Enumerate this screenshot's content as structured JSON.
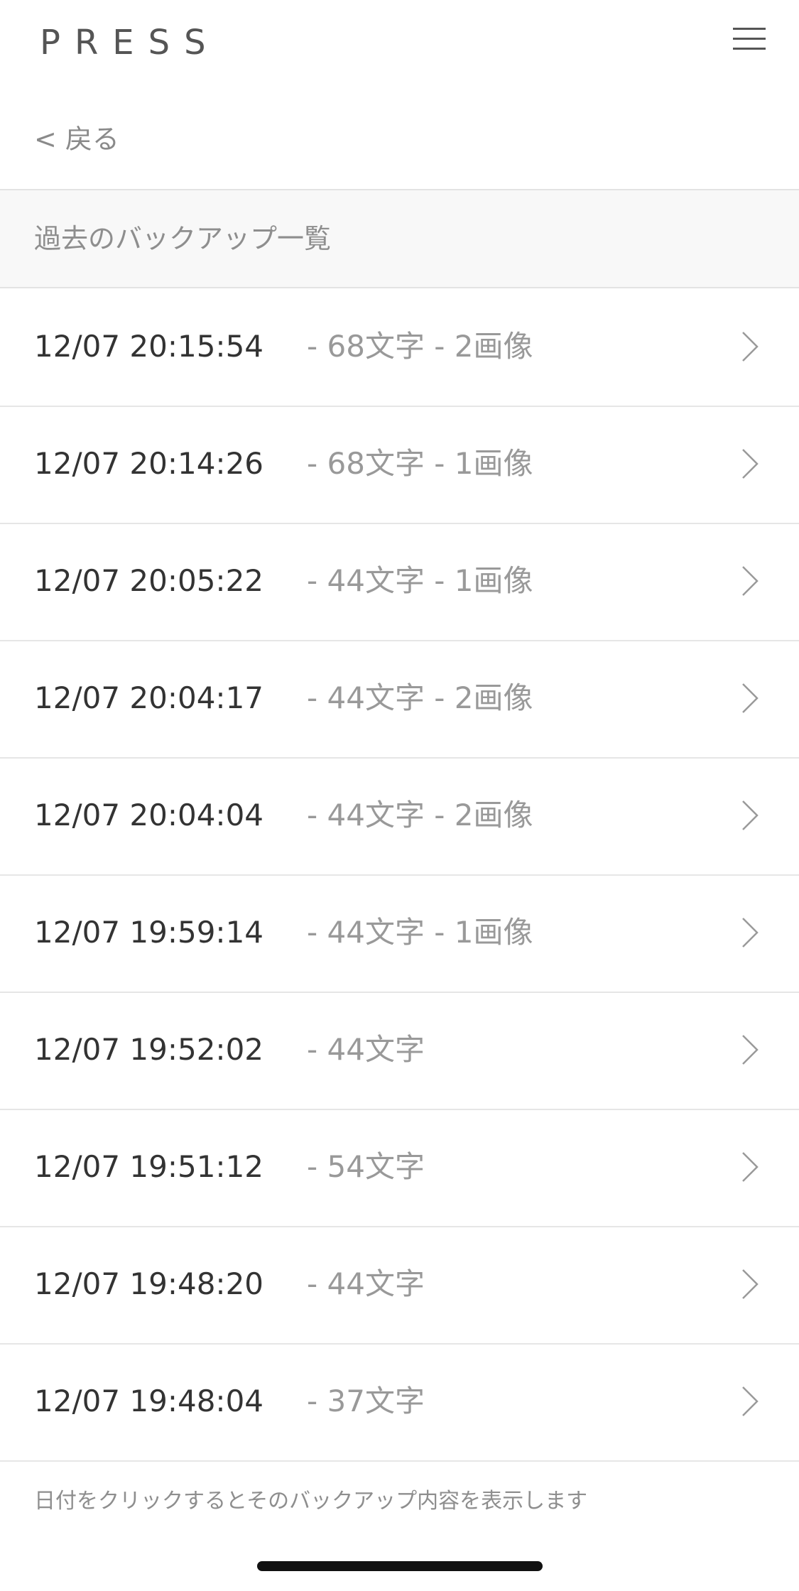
{
  "header": {
    "logo": "PRESS",
    "menu_icon": "hamburger-menu-icon"
  },
  "nav": {
    "back_label": "< 戻る"
  },
  "section": {
    "title": "過去のバックアップ一覧"
  },
  "backups": [
    {
      "date": "12/07 20:15:54",
      "meta": "- 68文字 - 2画像"
    },
    {
      "date": "12/07 20:14:26",
      "meta": "- 68文字 - 1画像"
    },
    {
      "date": "12/07 20:05:22",
      "meta": "- 44文字 - 1画像"
    },
    {
      "date": "12/07 20:04:17",
      "meta": "- 44文字 - 2画像"
    },
    {
      "date": "12/07 20:04:04",
      "meta": "- 44文字 - 2画像"
    },
    {
      "date": "12/07 19:59:14",
      "meta": "- 44文字 - 1画像"
    },
    {
      "date": "12/07 19:52:02",
      "meta": "- 44文字"
    },
    {
      "date": "12/07 19:51:12",
      "meta": "- 54文字"
    },
    {
      "date": "12/07 19:48:20",
      "meta": "- 44文字"
    },
    {
      "date": "12/07 19:48:04",
      "meta": "- 37文字"
    }
  ],
  "footer": {
    "note": "日付をクリックするとそのバックアップ内容を表示します"
  },
  "colors": {
    "text_primary": "#333333",
    "text_secondary": "#999999",
    "divider": "#e6e6e6",
    "section_bg": "#f8f8f8"
  }
}
